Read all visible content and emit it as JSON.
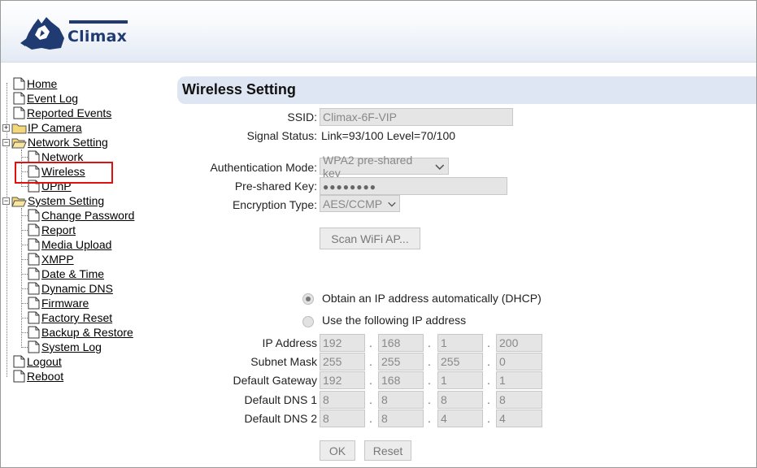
{
  "brand": {
    "name": "Climax"
  },
  "nav": {
    "home": "Home",
    "event_log": "Event Log",
    "reported_events": "Reported Events",
    "ip_camera": "IP Camera",
    "network_setting": "Network Setting",
    "network": "Network",
    "wireless": "Wireless",
    "upnp": "UPnP",
    "system_setting": "System Setting",
    "change_password": "Change Password",
    "report": "Report",
    "media_upload": "Media Upload",
    "xmpp": "XMPP",
    "date_time": "Date & Time",
    "dynamic_dns": "Dynamic DNS",
    "firmware": "Firmware",
    "factory_reset": "Factory Reset",
    "backup_restore": "Backup & Restore",
    "system_log": "System Log",
    "logout": "Logout",
    "reboot": "Reboot"
  },
  "page": {
    "title": "Wireless Setting"
  },
  "form": {
    "ssid_label": "SSID:",
    "ssid_value": "Climax-6F-VIP",
    "signal_label": "Signal Status:",
    "signal_value": "Link=93/100 Level=70/100",
    "auth_label": "Authentication Mode:",
    "auth_value": "WPA2 pre-shared key",
    "psk_label": "Pre-shared Key:",
    "psk_value": "●●●●●●●●",
    "enc_label": "Encryption Type:",
    "enc_value": "AES/CCMP",
    "scan_button": "Scan WiFi AP...",
    "dhcp_option": "Obtain an IP address automatically (DHCP)",
    "static_option": "Use the following IP address",
    "ip_label": "IP Address",
    "ip": [
      "192",
      "168",
      "1",
      "200"
    ],
    "mask_label": "Subnet Mask",
    "mask": [
      "255",
      "255",
      "255",
      "0"
    ],
    "gw_label": "Default Gateway",
    "gw": [
      "192",
      "168",
      "1",
      "1"
    ],
    "dns1_label": "Default DNS 1",
    "dns1": [
      "8",
      "8",
      "8",
      "8"
    ],
    "dns2_label": "Default DNS 2",
    "dns2": [
      "8",
      "8",
      "4",
      "4"
    ],
    "separator": ".",
    "ok_button": "OK",
    "reset_button": "Reset"
  },
  "colors": {
    "brand": "#203a72",
    "panel": "#dde6f2",
    "highlight": "#e01010"
  }
}
